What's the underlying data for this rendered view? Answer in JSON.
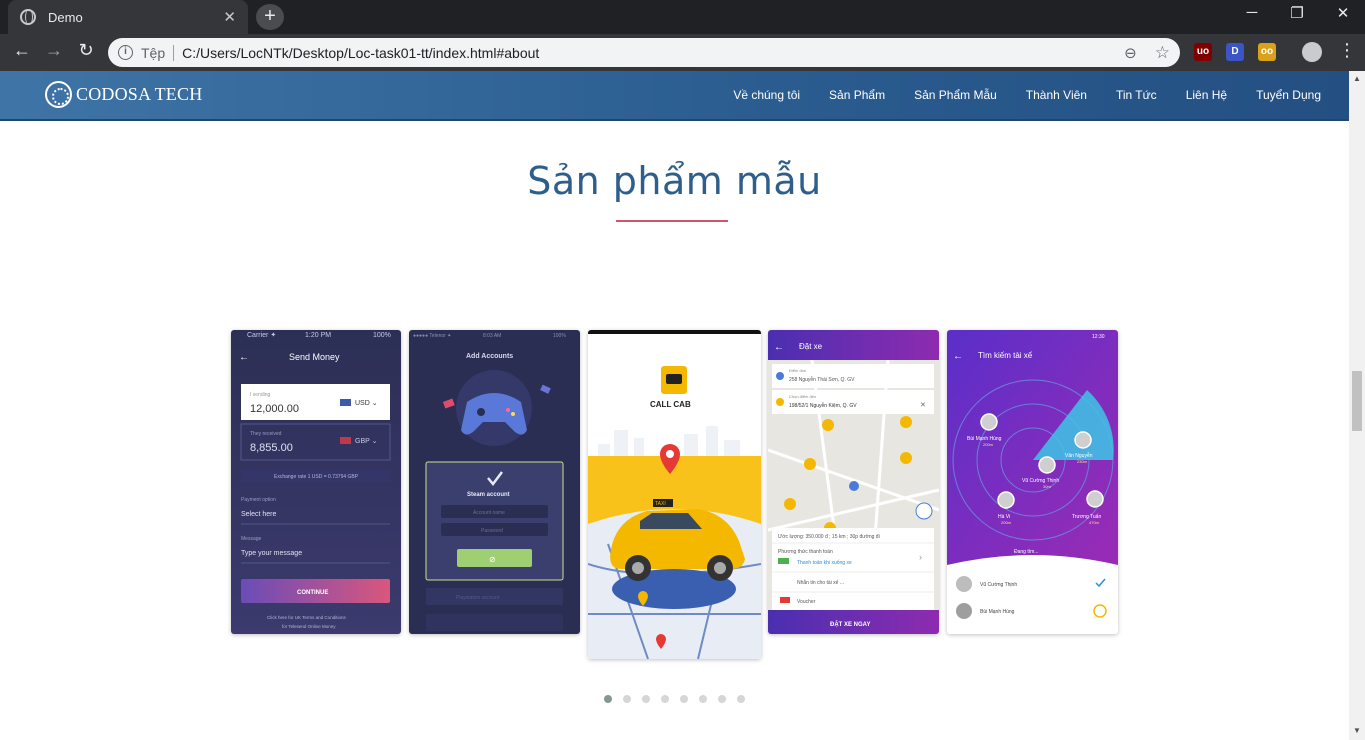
{
  "browser": {
    "tab_title": "Demo",
    "tab_close": "✕",
    "new_tab": "+",
    "window_min": "─",
    "window_max": "❐",
    "window_close": "✕",
    "back": "←",
    "forward": "→",
    "reload": "↻",
    "info": "i",
    "scheme": "Tệp",
    "url": "C:/Users/LocNTk/Desktop/Loc-task01-tt/index.html#about",
    "zoom_icon": "⊖",
    "star_icon": "☆",
    "menu_icon": "⋮",
    "extensions": [
      {
        "label": "uo",
        "color": "#800000"
      },
      {
        "label": "D",
        "color": "#3b55c4"
      },
      {
        "label": "oo",
        "color": "#d9a21a"
      }
    ]
  },
  "site": {
    "brand": "CODOSA TECH",
    "nav": [
      "Về chúng tôi",
      "Sản Phẩm",
      "Sản Phẩm Mẫu",
      "Thành Viên",
      "Tin Tức",
      "Liên Hệ",
      "Tuyển Dụng"
    ]
  },
  "section": {
    "title": "Sản phẩm mẫu",
    "underline_color": "#d3536a"
  },
  "cards": {
    "send_money": {
      "status_carrier": "Carrier ✦",
      "status_time": "1:20 PM",
      "status_batt": "100%",
      "title": "Send Money",
      "sending_label": "I sending",
      "sending_amount": "12,000.00",
      "sending_currency": "USD ⌄",
      "receive_label": "They received",
      "receive_amount": "8,855.00",
      "receive_currency": "GBP ⌄",
      "rate": "Exchange rate 1 USD = 0.73794 GBP",
      "payment_label": "Payment option",
      "payment_value": "Select here",
      "message_label": "Message",
      "message_value": "Type your message",
      "cta": "CONTINUE",
      "footer1": "Click here for UK Terms and Conditions",
      "footer2": "for Telesend Online Money"
    },
    "add_accounts": {
      "status_left": "●●●●● Telenor ✦",
      "status_time": "8:03 AM",
      "status_batt": "100%",
      "title": "Add Accounts",
      "box_title": "Steam account",
      "field1": "Account name",
      "field2": "Password",
      "row": "Playstation account"
    },
    "call_cab": {
      "brand": "CALL CAB",
      "sign": "TAXI"
    },
    "dat_xe": {
      "title": "Đặt xe",
      "pickup_label": "Điểm đón",
      "pickup_value": "258 Nguyễn Thái Sơn, Q. GV",
      "drop_label": "Chọn điểm đến",
      "drop_value": "198/52/1 Nguyễn Kiệm, Q. GV",
      "estimate": "Ước lượng: 350.000 đ ; 15 km ; 30p đường đi",
      "payment_label": "Phương thức thanh toán",
      "payment_value": "Thanh toán khi xuống xe",
      "driver_note": "Nhắn tin cho tài xế ...",
      "voucher": "Voucher",
      "cta": "ĐẶT XE NGAY"
    },
    "tim_kiem": {
      "status_time": "12:30",
      "title": "Tìm kiếm tài xế",
      "drivers": [
        {
          "name": "Bùi Mạnh Hùng",
          "dist": "200m"
        },
        {
          "name": "Văn Nguyễn",
          "dist": "230m"
        },
        {
          "name": "Vũ Cường Thịnh",
          "dist": "30m"
        },
        {
          "name": "Hà Vi",
          "dist": "200m"
        },
        {
          "name": "Trương Tuấn",
          "dist": "470m"
        }
      ],
      "searching": "Đang tìm...",
      "list": [
        "Vũ Cường Thịnh",
        "Bùi Mạnh Hùng"
      ]
    }
  },
  "carousel": {
    "dot_count": 8,
    "active_index": 0
  }
}
